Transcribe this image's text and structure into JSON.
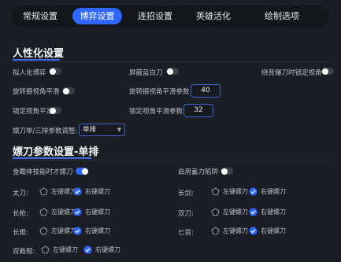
{
  "tabs": [
    "常规设置",
    "博弈设置",
    "连招设置",
    "英雄活化",
    "绘制选项"
  ],
  "active_tab": "博弈设置",
  "section1": {
    "title": "人性化设置",
    "humanize_label": "拟人化博弈",
    "block_knife_label": "屏蔽蓝白刀",
    "back_knife_label": "绕背爆刀时锁定视角",
    "spin_smooth_label": "旋转振视角平滑",
    "spin_smooth_param_label": "旋转振视角平滑参数",
    "spin_smooth_param_value": "40",
    "lock_smooth_label": "锁定视角平滑",
    "lock_smooth_param_label": "锁定视角平滑参数",
    "lock_smooth_param_value": "32",
    "mode_label": "嫖刀单/三排参数调整:",
    "mode_value": "单排"
  },
  "section2": {
    "title": "嫖刀参数设置-单排",
    "golden_body_label": "金霸体技能时才嫖刀",
    "charge_trap_label": "启用蓄力陷阱",
    "left_label": "左键嫖刀",
    "right_label": "右键嫖刀",
    "weapons_left": [
      "太刀:",
      "长枪:",
      "长棍:",
      "双截棍:"
    ],
    "weapons_right": [
      "长剑:",
      "双刀:",
      "匕首:"
    ]
  },
  "colors": {
    "accent": "#2f66ff",
    "background": "#1b1e25"
  },
  "icons": [
    "caret-down-icon",
    "pentagon-unchecked-icon",
    "check-circle-icon"
  ]
}
